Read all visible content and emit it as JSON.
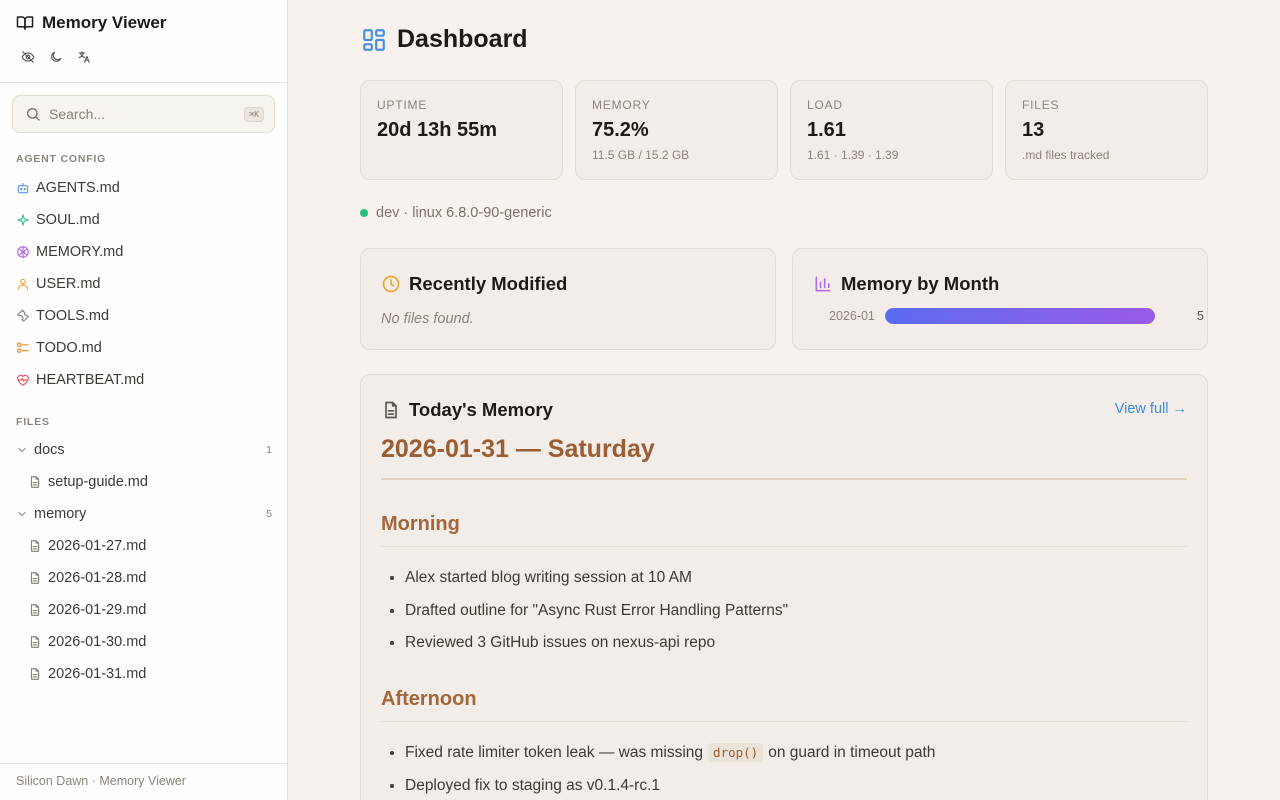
{
  "app": {
    "title": "Memory Viewer",
    "tools": [
      "eye-off-icon",
      "moon-icon",
      "translate-icon"
    ]
  },
  "search": {
    "placeholder": "Search...",
    "shortcut": "⌘K"
  },
  "sidebar": {
    "agent_config_label": "AGENT CONFIG",
    "agent_files": [
      {
        "label": "AGENTS.md",
        "icon": "robot-icon",
        "color": "#5b9ae8"
      },
      {
        "label": "SOUL.md",
        "icon": "sparkle-icon",
        "color": "#3cc39a"
      },
      {
        "label": "MEMORY.md",
        "icon": "brain-icon",
        "color": "#b36be0"
      },
      {
        "label": "USER.md",
        "icon": "user-icon",
        "color": "#e8a23a"
      },
      {
        "label": "TOOLS.md",
        "icon": "wrench-icon",
        "color": "#8c847c"
      },
      {
        "label": "TODO.md",
        "icon": "checklist-icon",
        "color": "#e8903a"
      },
      {
        "label": "HEARTBEAT.md",
        "icon": "heart-pulse-icon",
        "color": "#e25a6a"
      }
    ],
    "files_label": "FILES",
    "folders": [
      {
        "name": "docs",
        "count": "1",
        "files": [
          "setup-guide.md"
        ]
      },
      {
        "name": "memory",
        "count": "5",
        "files": [
          "2026-01-27.md",
          "2026-01-28.md",
          "2026-01-29.md",
          "2026-01-30.md",
          "2026-01-31.md"
        ]
      }
    ],
    "footer": "Silicon Dawn · Memory Viewer"
  },
  "dashboard": {
    "title": "Dashboard",
    "stats": [
      {
        "label": "UPTIME",
        "value": "20d 13h 55m",
        "sub": ""
      },
      {
        "label": "MEMORY",
        "value": "75.2%",
        "sub": "11.5 GB / 15.2 GB"
      },
      {
        "label": "LOAD",
        "value": "1.61",
        "sub": "1.61 · 1.39 · 1.39"
      },
      {
        "label": "FILES",
        "value": "13",
        "sub": ".md files tracked"
      }
    ],
    "host": "dev · linux 6.8.0-90-generic",
    "status_color": "#22c07a",
    "recent": {
      "title": "Recently Modified",
      "empty": "No files found."
    },
    "by_month": {
      "title": "Memory by Month",
      "rows": [
        {
          "month": "2026-01",
          "count": "5",
          "fraction": 1.0
        }
      ]
    },
    "today": {
      "title": "Today's Memory",
      "view_full": "View full →",
      "heading": "2026-01-31 — Saturday",
      "sections": [
        {
          "heading": "Morning",
          "items": [
            {
              "pre": "Alex started blog writing session at 10 AM"
            },
            {
              "pre": "Drafted outline for \"Async Rust Error Handling Patterns\""
            },
            {
              "pre": "Reviewed 3 GitHub issues on nexus-api repo"
            }
          ]
        },
        {
          "heading": "Afternoon",
          "items": [
            {
              "pre": "Fixed rate limiter token leak — was missing",
              "code": "drop()",
              "post": "on guard in timeout path"
            },
            {
              "pre": "Deployed fix to staging as v0.1.4-rc.1"
            }
          ]
        }
      ]
    }
  }
}
